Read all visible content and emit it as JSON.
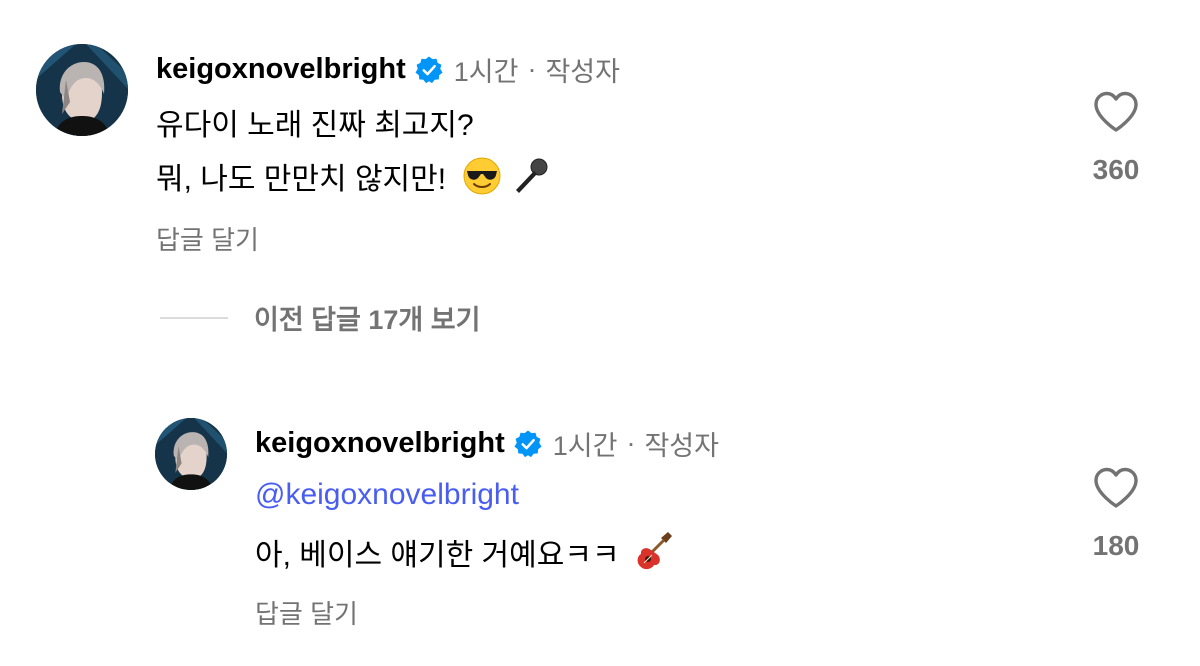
{
  "comment1": {
    "username": "keigoxnovelbright",
    "time": "1시간",
    "author_tag": "작성자",
    "lines": [
      "유다이 노래 진짜 최고지?",
      "뭐, 나도 만만치 않지만!"
    ],
    "emojis": [
      "sunglasses-emoji",
      "microphone-emoji"
    ],
    "reply_label": "답글 달기",
    "likes": "360"
  },
  "view_replies": {
    "label": "이전 답글 17개 보기"
  },
  "comment2": {
    "username": "keigoxnovelbright",
    "time": "1시간",
    "author_tag": "작성자",
    "mention": "@keigoxnovelbright",
    "line": "아, 베이스 얘기한 거예요ㅋㅋ",
    "emojis": [
      "guitar-emoji"
    ],
    "reply_label": "답글 달기",
    "likes": "180"
  },
  "colors": {
    "secondary_text": "#737373",
    "mention": "#4a5df2",
    "verified": "#0095f6"
  }
}
